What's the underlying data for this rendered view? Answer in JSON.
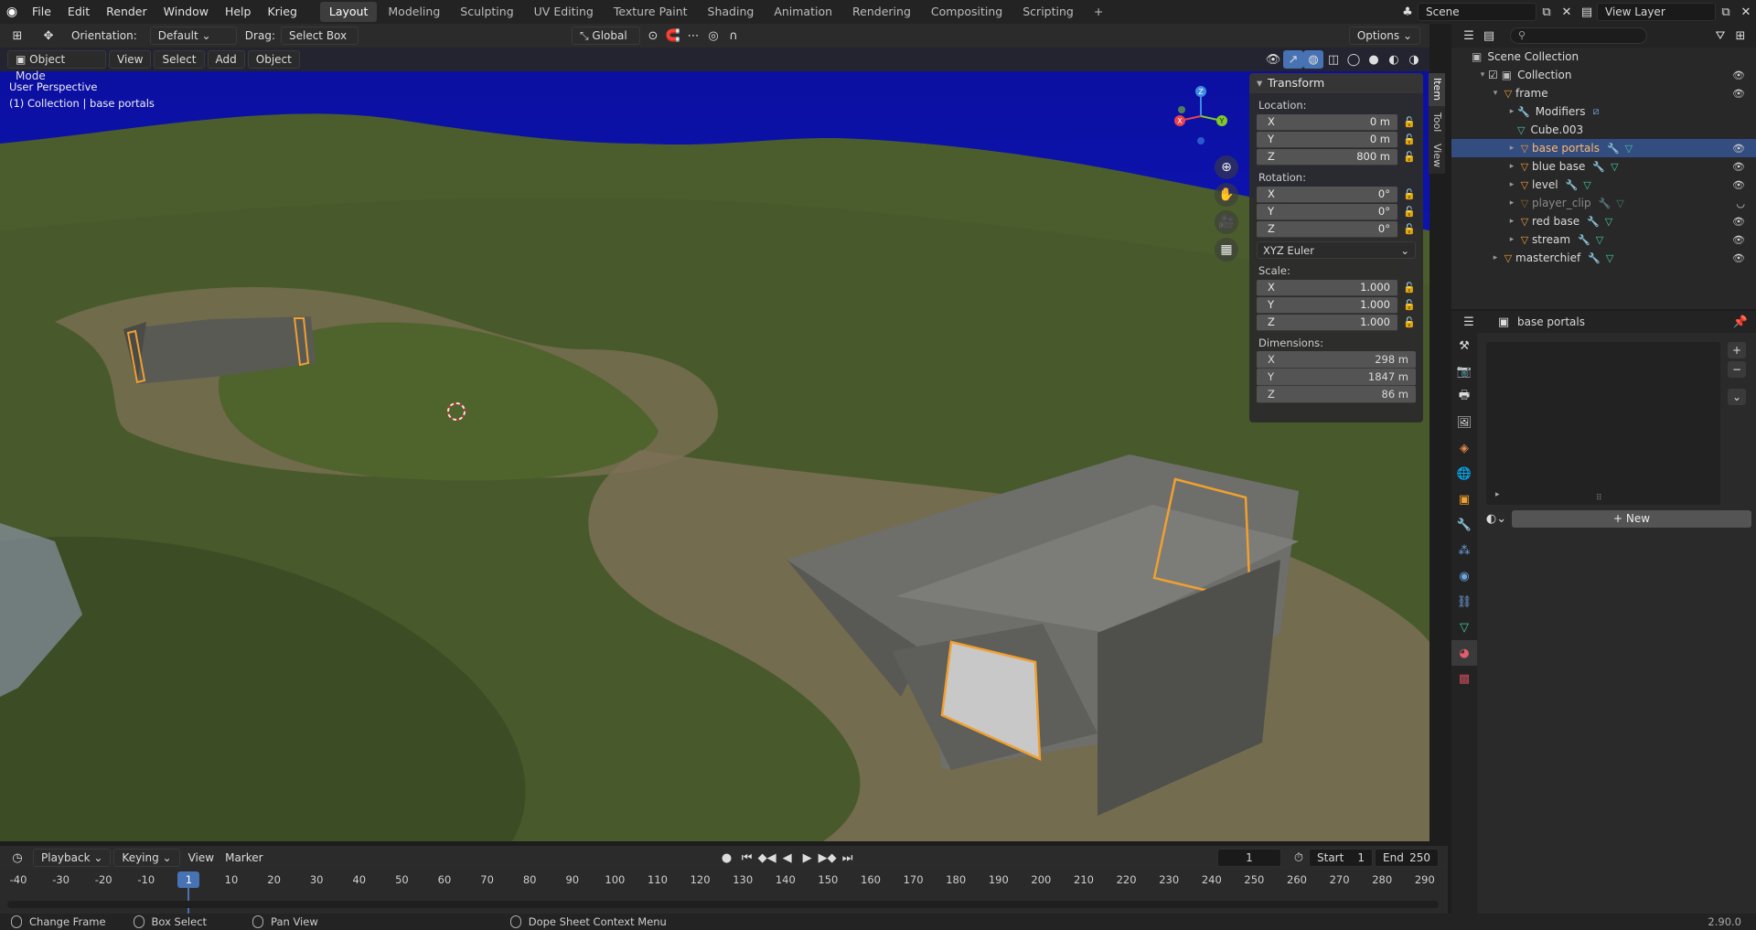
{
  "topbar": {
    "menus": [
      "File",
      "Edit",
      "Render",
      "Window",
      "Help",
      "Krieg"
    ],
    "workspaces": [
      "Layout",
      "Modeling",
      "Sculpting",
      "UV Editing",
      "Texture Paint",
      "Shading",
      "Animation",
      "Rendering",
      "Compositing",
      "Scripting"
    ],
    "active_workspace": "Layout",
    "scene": "Scene",
    "view_layer": "View Layer"
  },
  "toolrow": {
    "orientation_label": "Orientation:",
    "orientation_value": "Default",
    "drag_label": "Drag:",
    "drag_value": "Select Box",
    "transform_space": "Global",
    "options": "Options"
  },
  "viewport_header": {
    "mode": "Object Mode",
    "menus": [
      "View",
      "Select",
      "Add",
      "Object"
    ]
  },
  "viewport": {
    "perspective": "User Perspective",
    "collection_info": "(1) Collection | base portals"
  },
  "npanel": {
    "title": "Transform",
    "location_label": "Location:",
    "location": [
      {
        "axis": "X",
        "value": "0 m"
      },
      {
        "axis": "Y",
        "value": "0 m"
      },
      {
        "axis": "Z",
        "value": "800 m"
      }
    ],
    "rotation_label": "Rotation:",
    "rotation": [
      {
        "axis": "X",
        "value": "0°"
      },
      {
        "axis": "Y",
        "value": "0°"
      },
      {
        "axis": "Z",
        "value": "0°"
      }
    ],
    "rotation_mode": "XYZ Euler",
    "scale_label": "Scale:",
    "scale": [
      {
        "axis": "X",
        "value": "1.000"
      },
      {
        "axis": "Y",
        "value": "1.000"
      },
      {
        "axis": "Z",
        "value": "1.000"
      }
    ],
    "dimensions_label": "Dimensions:",
    "dimensions": [
      {
        "axis": "X",
        "value": "298 m"
      },
      {
        "axis": "Y",
        "value": "1847 m"
      },
      {
        "axis": "Z",
        "value": "86 m"
      }
    ],
    "tabs": [
      "Item",
      "Tool",
      "View"
    ]
  },
  "outliner": {
    "root": "Scene Collection",
    "rows": [
      {
        "label": "Collection"
      },
      {
        "label": "frame"
      },
      {
        "label": "Modifiers"
      },
      {
        "label": "Cube.003"
      },
      {
        "label": "base portals"
      },
      {
        "label": "blue base"
      },
      {
        "label": "level"
      },
      {
        "label": "player_clip"
      },
      {
        "label": "red base"
      },
      {
        "label": "stream"
      },
      {
        "label": "masterchief"
      }
    ]
  },
  "properties": {
    "object_name": "base portals",
    "new_button": "New"
  },
  "timeline": {
    "menus": [
      "Playback",
      "Keying",
      "View",
      "Marker"
    ],
    "current_frame": "1",
    "start_label": "Start",
    "start": "1",
    "end_label": "End",
    "end": "250",
    "ticks": [
      "-40",
      "-30",
      "-20",
      "-10",
      "1",
      "10",
      "20",
      "30",
      "40",
      "50",
      "60",
      "70",
      "80",
      "90",
      "100",
      "110",
      "120",
      "130",
      "140",
      "150",
      "160",
      "170",
      "180",
      "190",
      "200",
      "210",
      "220",
      "230",
      "240",
      "250",
      "260",
      "270",
      "280",
      "290"
    ]
  },
  "statusbar": {
    "items": [
      "Change Frame",
      "Box Select",
      "Pan View",
      "Dope Sheet Context Menu"
    ],
    "version": "2.90.0"
  }
}
